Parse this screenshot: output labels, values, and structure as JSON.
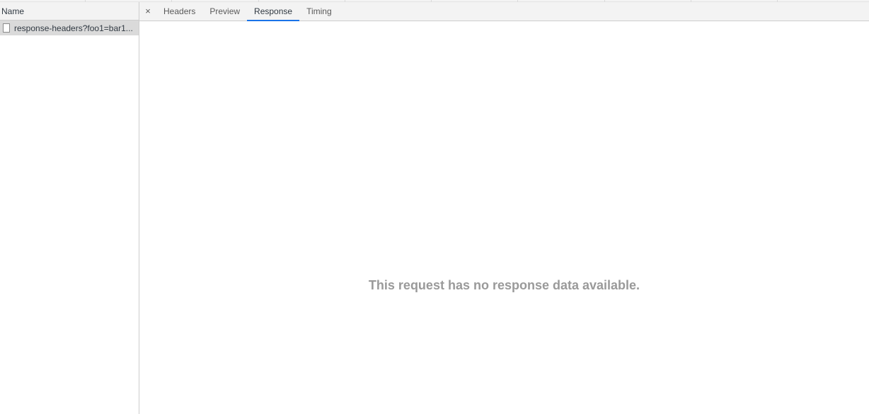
{
  "requests_pane": {
    "column_header": "Name",
    "rows": [
      {
        "name": "response-headers?foo1=bar1...",
        "selected": true,
        "icon": "document-icon"
      }
    ]
  },
  "details_pane": {
    "close_label": "×",
    "tabs": [
      {
        "label": "Headers",
        "selected": false
      },
      {
        "label": "Preview",
        "selected": false
      },
      {
        "label": "Response",
        "selected": true
      },
      {
        "label": "Timing",
        "selected": false
      }
    ],
    "empty_message": "This request has no response data available."
  },
  "colors": {
    "accent": "#1a73e8",
    "selected_row": "#dadada",
    "empty_text": "#9a9a9a"
  }
}
